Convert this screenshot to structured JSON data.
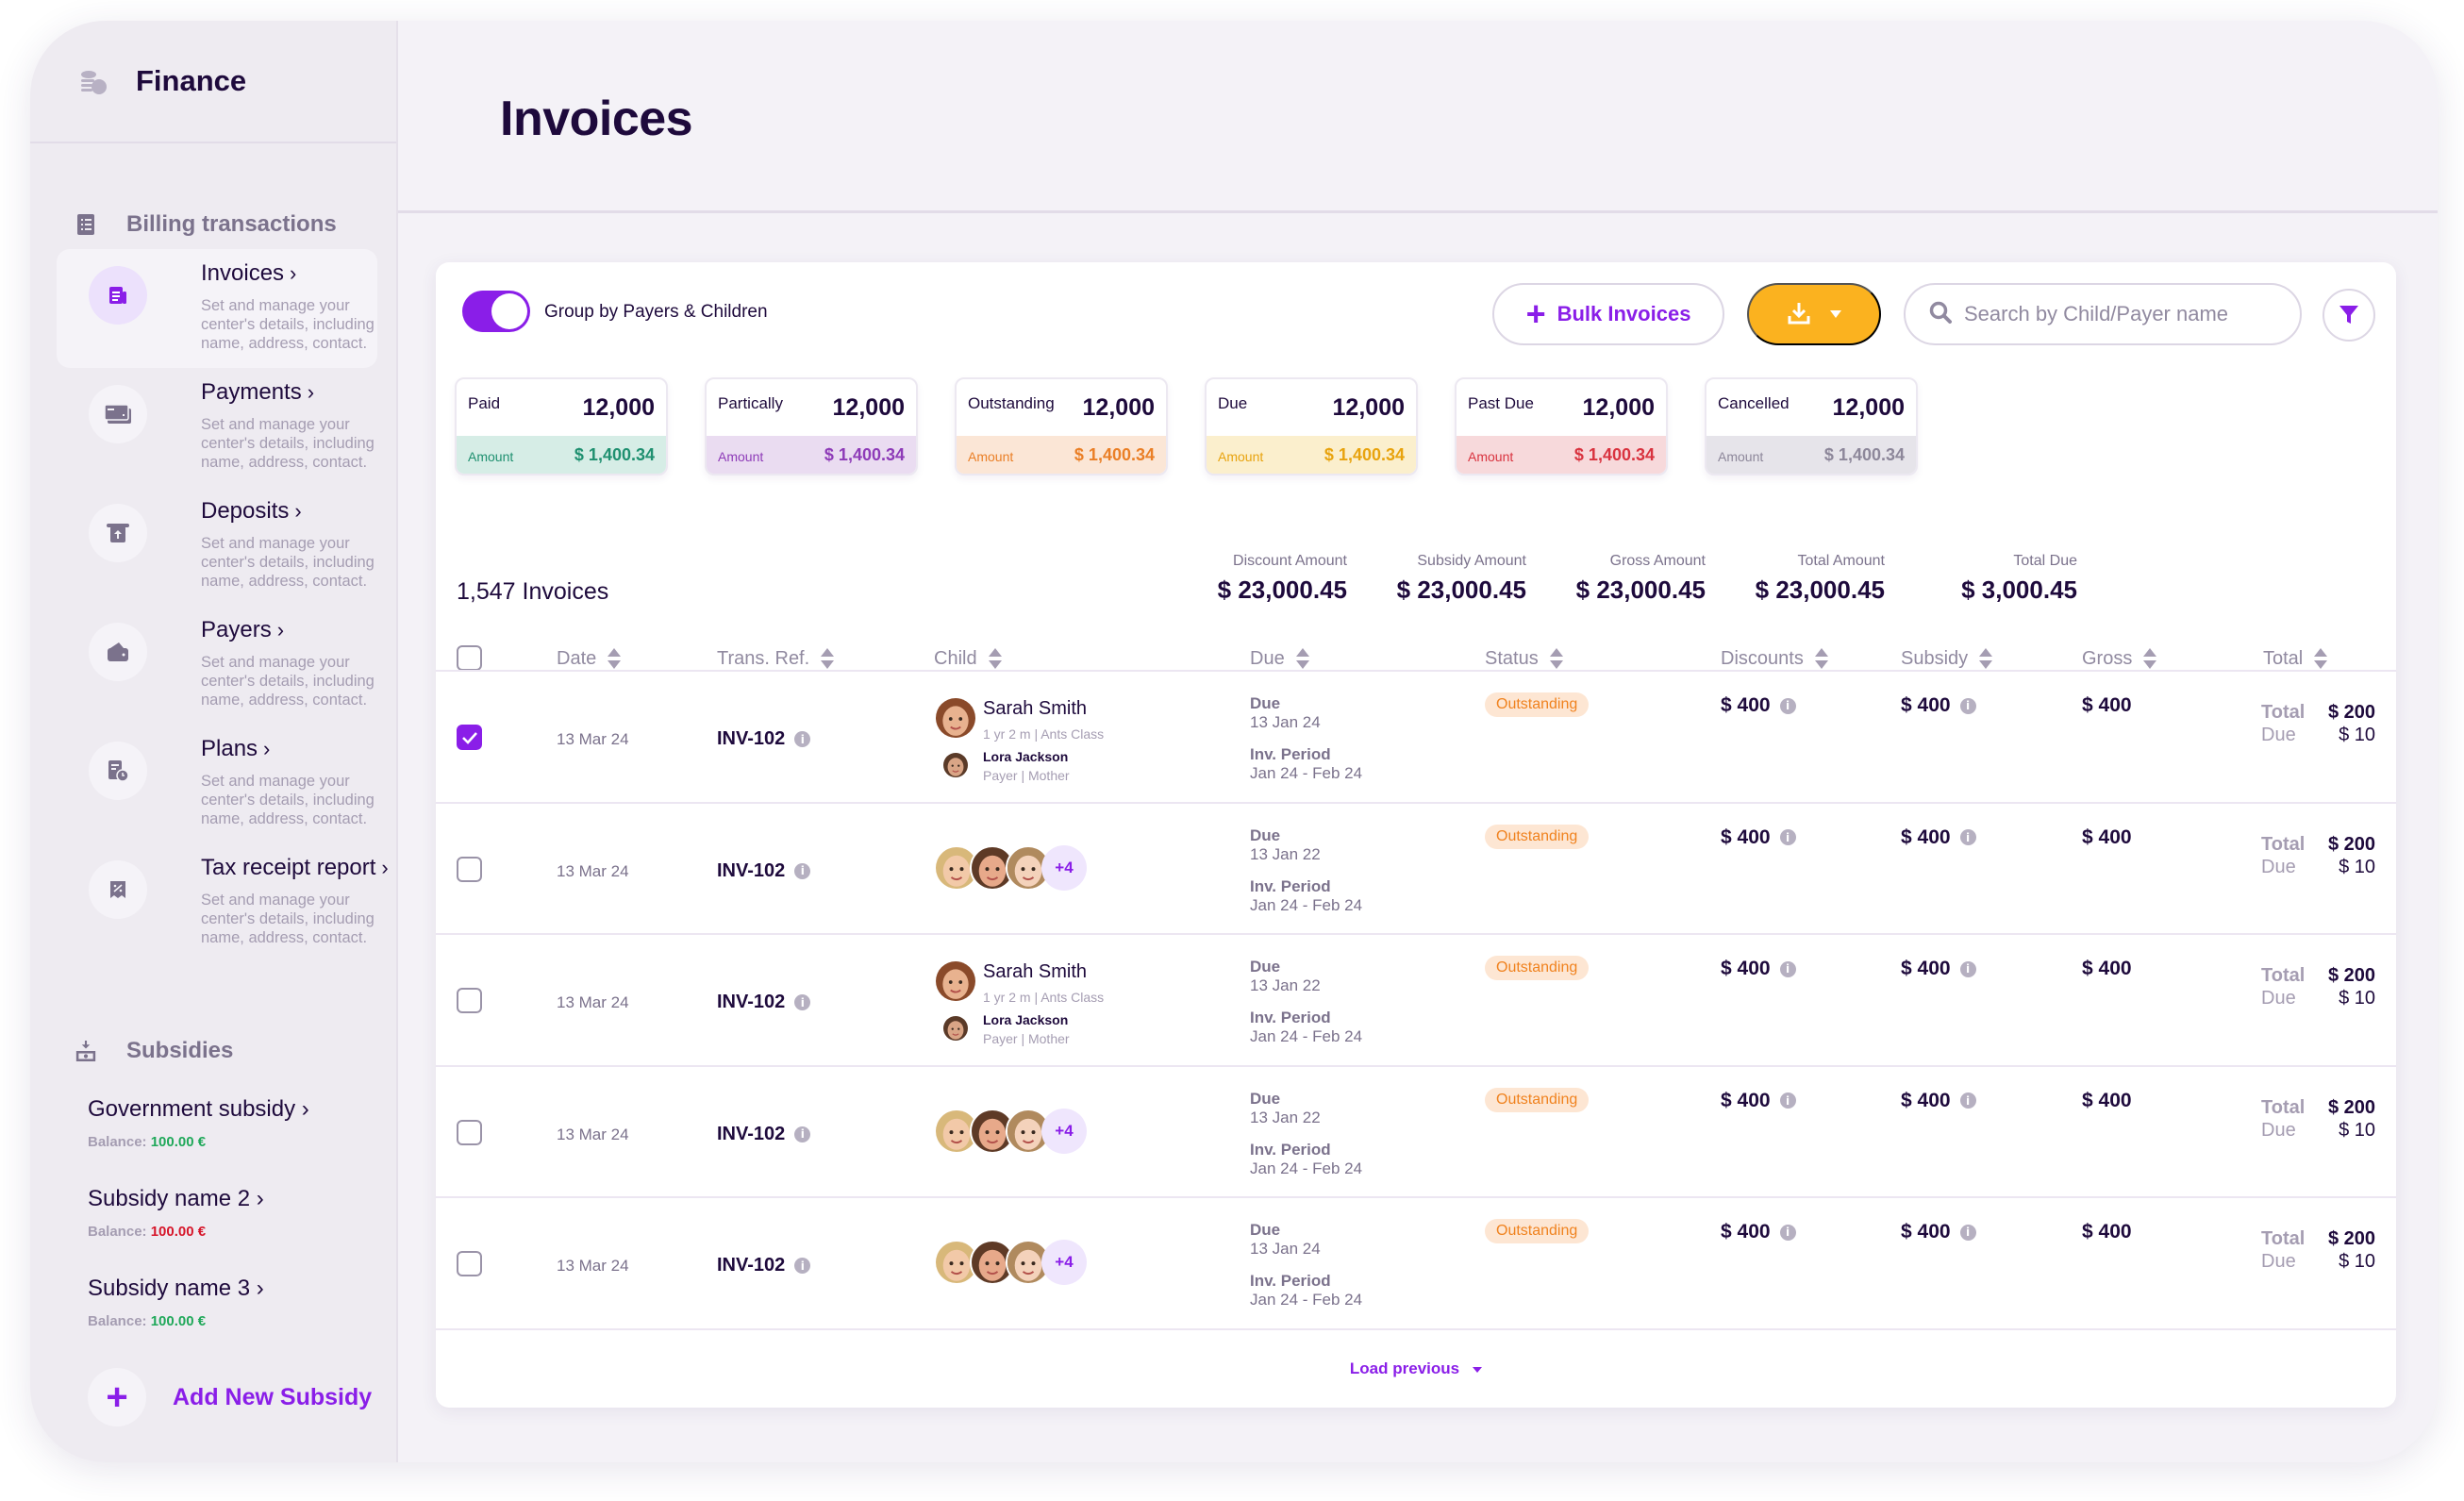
{
  "sidebar": {
    "app_title": "Finance",
    "billing_section_title": "Billing transactions",
    "nav_items": [
      {
        "label": "Invoices",
        "desc": "Set and manage your center's details, including name, address, contact.",
        "active": true
      },
      {
        "label": "Payments",
        "desc": "Set and manage your center's details, including name, address, contact."
      },
      {
        "label": "Deposits",
        "desc": "Set and manage your center's details, including name, address, contact."
      },
      {
        "label": "Payers",
        "desc": "Set and manage your center's details, including name, address, contact."
      },
      {
        "label": "Plans",
        "desc": "Set and manage your center's details, including name, address, contact."
      },
      {
        "label": "Tax receipt report",
        "desc": "Set and manage your center's details, including name, address, contact."
      }
    ],
    "subsidies_section_title": "Subsidies",
    "subsidies": [
      {
        "name": "Government subsidy",
        "balance_label": "Balance:",
        "balance": "100.00 €",
        "status": "positive"
      },
      {
        "name": "Subsidy name 2",
        "balance_label": "Balance:",
        "balance": "100.00 €",
        "status": "negative"
      },
      {
        "name": "Subsidy name 3",
        "balance_label": "Balance:",
        "balance": "100.00 €",
        "status": "positive"
      }
    ],
    "add_subsidy_label": "Add New Subsidy",
    "chevron": "›"
  },
  "header": {
    "title": "Invoices"
  },
  "toolbar": {
    "group_toggle_label": "Group by Payers & Children",
    "group_toggle_on": true,
    "bulk_invoices_label": "Bulk Invoices",
    "search_placeholder": "Search by Child/Payer name"
  },
  "status_cards": [
    {
      "label": "Paid",
      "count": "12,000",
      "amount_label": "Amount",
      "amount": "$ 1,400.34",
      "bg": "#d6ede6",
      "color": "#1f9070"
    },
    {
      "label": "Partically",
      "count": "12,000",
      "amount_label": "Amount",
      "amount": "$ 1,400.34",
      "bg": "#eadcf1",
      "color": "#8e3bb8"
    },
    {
      "label": "Outstanding",
      "count": "12,000",
      "amount_label": "Amount",
      "amount": "$ 1,400.34",
      "bg": "#fbe6d6",
      "color": "#ea7f26"
    },
    {
      "label": "Due",
      "count": "12,000",
      "amount_label": "Amount",
      "amount": "$ 1,400.34",
      "bg": "#fbefcd",
      "color": "#e8a30e"
    },
    {
      "label": "Past Due",
      "count": "12,000",
      "amount_label": "Amount",
      "amount": "$ 1,400.34",
      "bg": "#f7d9db",
      "color": "#d9333f"
    },
    {
      "label": "Cancelled",
      "count": "12,000",
      "amount_label": "Amount",
      "amount": "$ 1,400.34",
      "bg": "#e6e4ea",
      "color": "#8d879a"
    }
  ],
  "summary": {
    "count_label": "1,547 Invoices",
    "totals": [
      {
        "label": "Discount Amount",
        "value": "$ 23,000.45"
      },
      {
        "label": "Subsidy Amount",
        "value": "$ 23,000.45"
      },
      {
        "label": "Gross Amount",
        "value": "$ 23,000.45"
      },
      {
        "label": "Total Amount",
        "value": "$ 23,000.45"
      },
      {
        "label": "Total Due",
        "value": "$ 3,000.45"
      }
    ]
  },
  "table": {
    "columns": [
      "Date",
      "Trans. Ref.",
      "Child",
      "Due",
      "Status",
      "Discounts",
      "Subsidy",
      "Gross",
      "Total"
    ],
    "due_label": "Due",
    "period_label": "Inv. Period",
    "total_label": "Total",
    "due_short_label": "Due",
    "rows": [
      {
        "checked": true,
        "date": "13 Mar 24",
        "ref": "INV-102",
        "type": "single",
        "child_name": "Sarah Smith",
        "child_meta": "1 yr  2 m | Ants Class",
        "payer_name": "Lora Jackson",
        "payer_meta": "Payer | Mother",
        "due_date": "13 Jan 24",
        "period": "Jan 24 - Feb 24",
        "status": "Outstanding",
        "discounts": "$ 400",
        "subsidy": "$ 400",
        "gross": "$ 400",
        "total": "$ 200",
        "due": "$ 10"
      },
      {
        "checked": false,
        "date": "13 Mar 24",
        "ref": "INV-102",
        "type": "group",
        "more": "+4",
        "due_date": "13 Jan 22",
        "period": "Jan 24 - Feb 24",
        "status": "Outstanding",
        "discounts": "$ 400",
        "subsidy": "$ 400",
        "gross": "$ 400",
        "total": "$ 200",
        "due": "$ 10"
      },
      {
        "checked": false,
        "date": "13 Mar 24",
        "ref": "INV-102",
        "type": "single",
        "child_name": "Sarah Smith",
        "child_meta": "1 yr  2 m | Ants Class",
        "payer_name": "Lora Jackson",
        "payer_meta": "Payer | Mother",
        "due_date": "13 Jan 22",
        "period": "Jan 24 - Feb 24",
        "status": "Outstanding",
        "discounts": "$ 400",
        "subsidy": "$ 400",
        "gross": "$ 400",
        "total": "$ 200",
        "due": "$ 10"
      },
      {
        "checked": false,
        "date": "13 Mar 24",
        "ref": "INV-102",
        "type": "group",
        "more": "+4",
        "due_date": "13 Jan 22",
        "period": "Jan 24 - Feb 24",
        "status": "Outstanding",
        "discounts": "$ 400",
        "subsidy": "$ 400",
        "gross": "$ 400",
        "total": "$ 200",
        "due": "$ 10"
      },
      {
        "checked": false,
        "date": "13 Mar 24",
        "ref": "INV-102",
        "type": "group",
        "more": "+4",
        "due_date": "13 Jan 24",
        "period": "Jan 24 - Feb 24",
        "status": "Outstanding",
        "discounts": "$ 400",
        "subsidy": "$ 400",
        "gross": "$ 400",
        "total": "$ 200",
        "due": "$ 10"
      }
    ],
    "load_previous_label": "Load previous"
  },
  "colors": {
    "accent": "#8a1ee8",
    "download_button": "#fbb21f",
    "status_outstanding_bg": "#fde6d3",
    "status_outstanding_text": "#f0821e"
  }
}
